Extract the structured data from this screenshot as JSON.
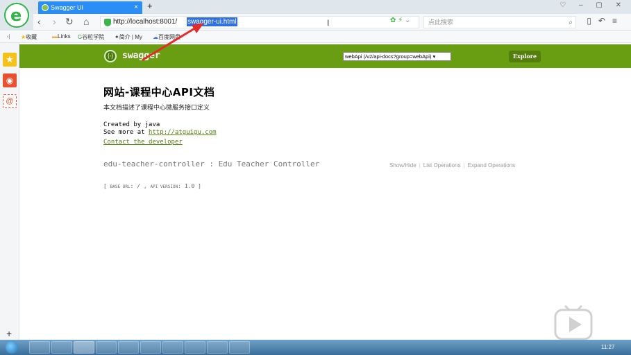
{
  "browser": {
    "tab_title": "Swagger UI",
    "tab_close": "×",
    "new_tab": "+",
    "window_controls": "♡ – ▢ ✕",
    "url_prefix": "http://localhost:8001/",
    "url_selected": "swagger-ui.html",
    "search_placeholder": "点此搜索",
    "nav_back": "‹",
    "nav_forward": "›",
    "nav_reload": "↻",
    "nav_home": "⌂"
  },
  "bookmarks": [
    {
      "label": "收藏"
    },
    {
      "label": "Links"
    },
    {
      "label": "谷粒学院"
    },
    {
      "label": "简介 | My"
    },
    {
      "label": "百度网盘-"
    }
  ],
  "sidebar": {
    "add_label": "+"
  },
  "swagger": {
    "title": "swagger",
    "logo_text": "{-}",
    "api_select": "webApi (/v2/api-docs?group=webApi) ▾",
    "explore_label": "Explore"
  },
  "content": {
    "api_title": "网站-课程中心API文档",
    "api_description": "本文档描述了课程中心微服务接口定义",
    "created_by": "Created by java",
    "see_more_prefix": "See more at ",
    "see_more_link": "http://atguigu.com",
    "contact": "Contact the developer",
    "controller": "edu-teacher-controller : Edu Teacher Controller",
    "ops": [
      "Show/Hide",
      "List Operations",
      "Expand Operations"
    ],
    "base_url_label": "BASE URL",
    "base_url_value": "/",
    "api_version_label": "API VERSION",
    "api_version_value": "1.0"
  },
  "taskbar": {
    "clock": "11:27"
  },
  "colors": {
    "swagger_green": "#6a9e12",
    "tab_blue": "#2b8ef5",
    "arrow_red": "#e52a2a",
    "link_green": "#547f0c"
  }
}
